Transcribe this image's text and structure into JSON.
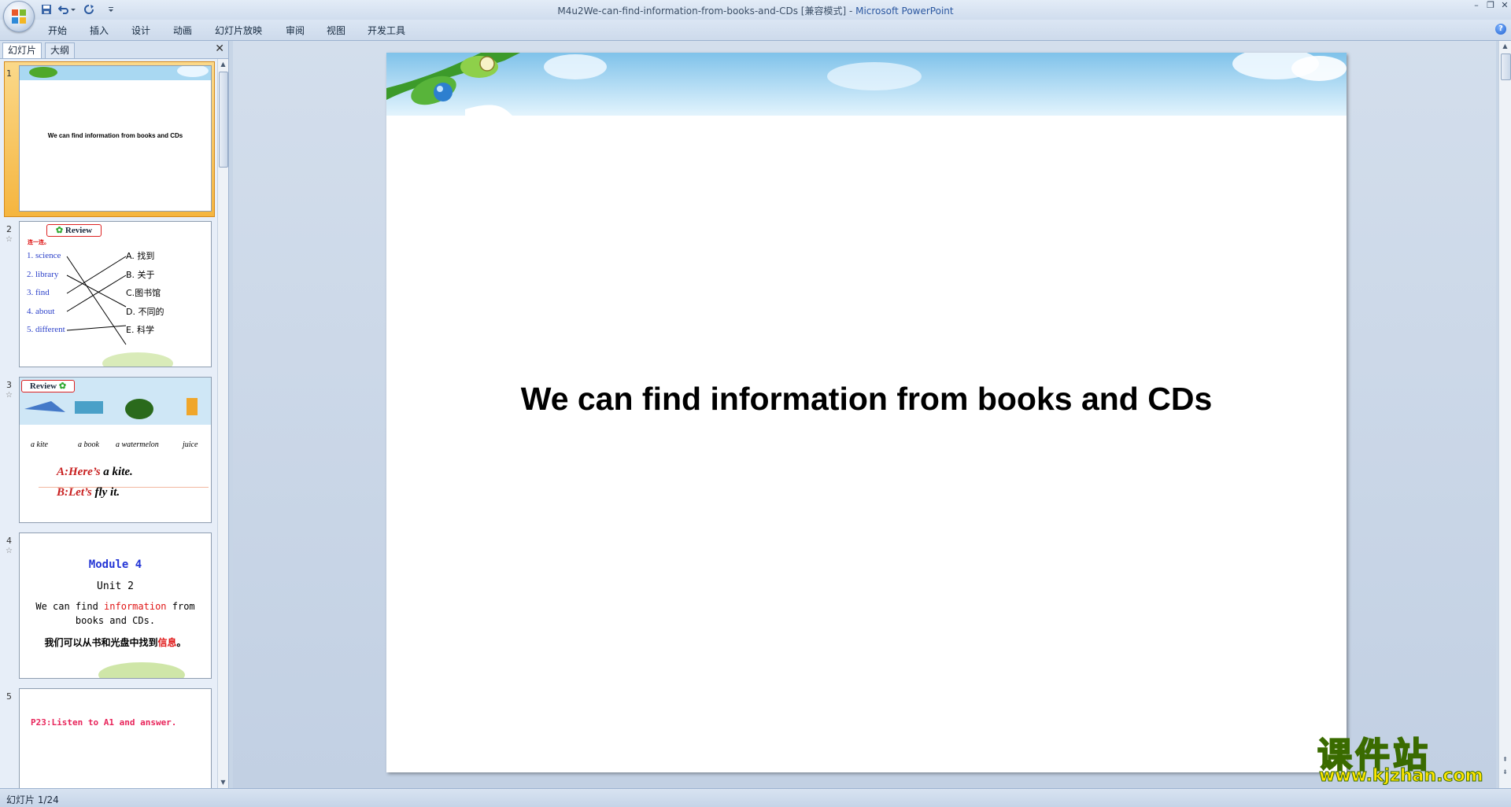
{
  "window": {
    "title_doc": "M4u2We-can-find-information-from-books-and-CDs [兼容模式]",
    "title_sep": " - ",
    "title_app": "Microsoft PowerPoint"
  },
  "ribbon": {
    "tabs": [
      "开始",
      "插入",
      "设计",
      "动画",
      "幻灯片放映",
      "审阅",
      "视图",
      "开发工具"
    ]
  },
  "pane": {
    "tabs": [
      "幻灯片",
      "大纲"
    ]
  },
  "thumbnails": {
    "s1": {
      "num": "1",
      "title": "We can find information from books and CDs"
    },
    "s2": {
      "num": "2",
      "header": "Review",
      "subhead": "连一连。",
      "left": [
        "1. science",
        "2. library",
        "3. find",
        "4. about",
        "5. different"
      ],
      "right": [
        "A.  找到",
        "B. 关于",
        "C.图书馆",
        "D. 不同的",
        "E. 科学"
      ]
    },
    "s3": {
      "num": "3",
      "header": "Review",
      "captions": [
        "a kite",
        "a book",
        "a watermelon",
        "juice"
      ],
      "line_a_red": "A:Here’s",
      "line_a_black": " a kite.",
      "line_b_red": "B:Let’s",
      "line_b_black": " fly it."
    },
    "s4": {
      "num": "4",
      "module": "Module  4",
      "unit": "Unit 2",
      "line1_pre": "We can find ",
      "line1_red": "information",
      "line1_post": " from",
      "line2": "books and CDs.",
      "cn_pre": "我们可以从书和光盘中找到",
      "cn_red": "信息",
      "cn_post": "。"
    },
    "s5": {
      "num": "5",
      "text": "P23:Listen to A1 and answer."
    }
  },
  "slide": {
    "title": "We can find information from books and CDs"
  },
  "status": {
    "text": "幻灯片 1/24"
  },
  "watermark": {
    "cn": "课件站",
    "url": "www.kjzhan.com"
  }
}
